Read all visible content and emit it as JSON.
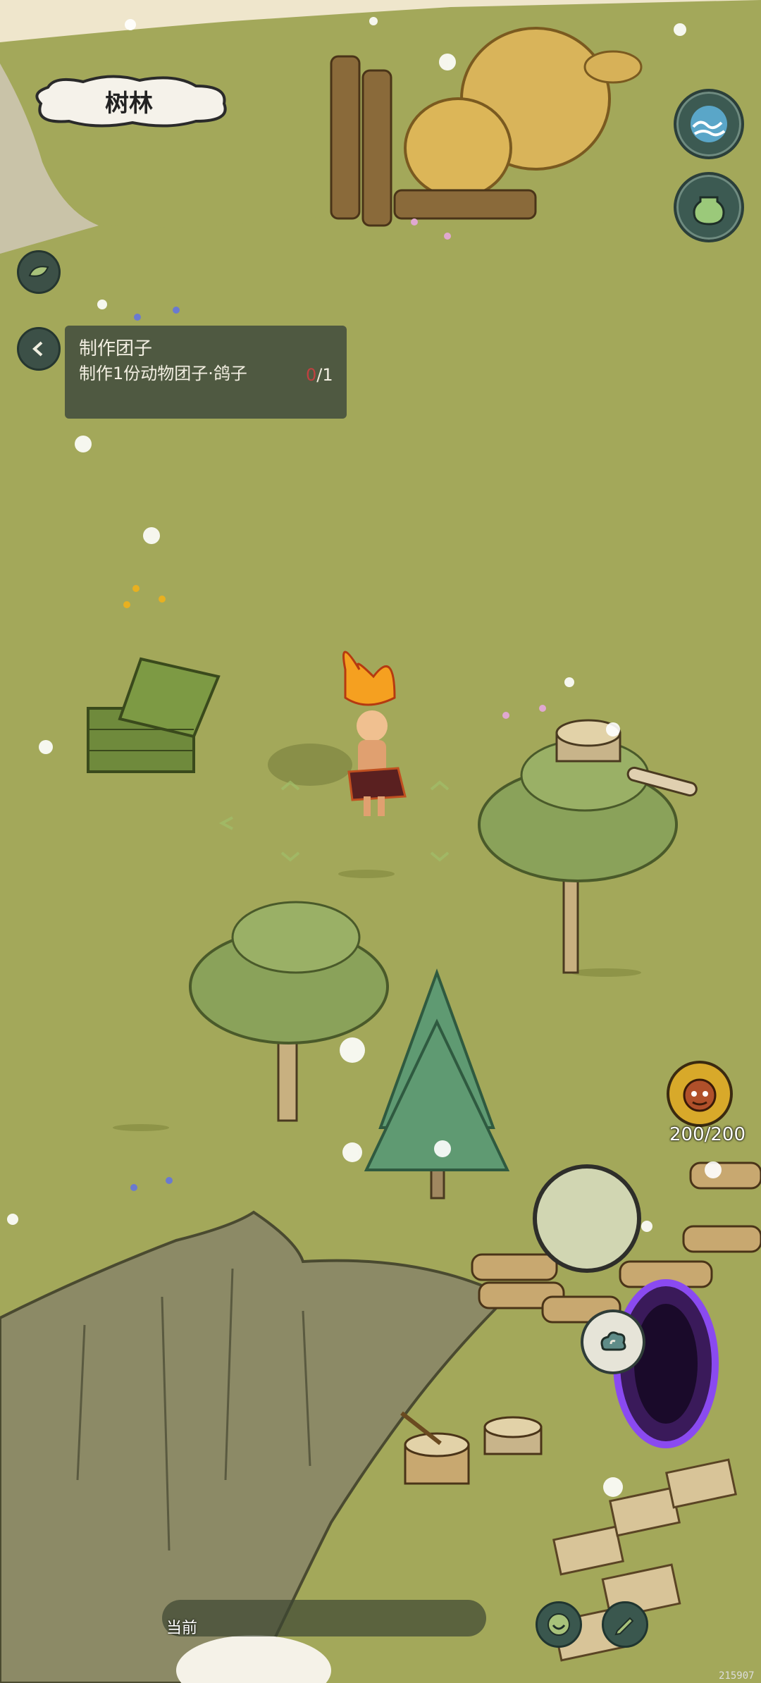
{
  "location": {
    "name": "树林"
  },
  "quest": {
    "title": "制作团子",
    "description": "制作1份动物团子·鸽子",
    "progress_current": "0",
    "progress_total": "/1"
  },
  "player": {
    "hp_text": "200/200"
  },
  "bottom_bar": {
    "label": "当前"
  },
  "build_tag": "215907",
  "colors": {
    "grass": "#a3a85a",
    "cliff": "#8c8a66",
    "panel": "#46503e",
    "hud_button": "#3c5a52",
    "portal": "#6b2fd0"
  },
  "icons": {
    "water_button": "wave-icon",
    "bag_button": "pot-icon",
    "collapse_button": "leaf-icon",
    "back_button": "chevron-left-icon",
    "hp_badge": "monkey-face-icon",
    "swirl_button": "cloud-swirl-icon",
    "emote_button": "smile-icon",
    "edit_button": "pencil-icon"
  }
}
